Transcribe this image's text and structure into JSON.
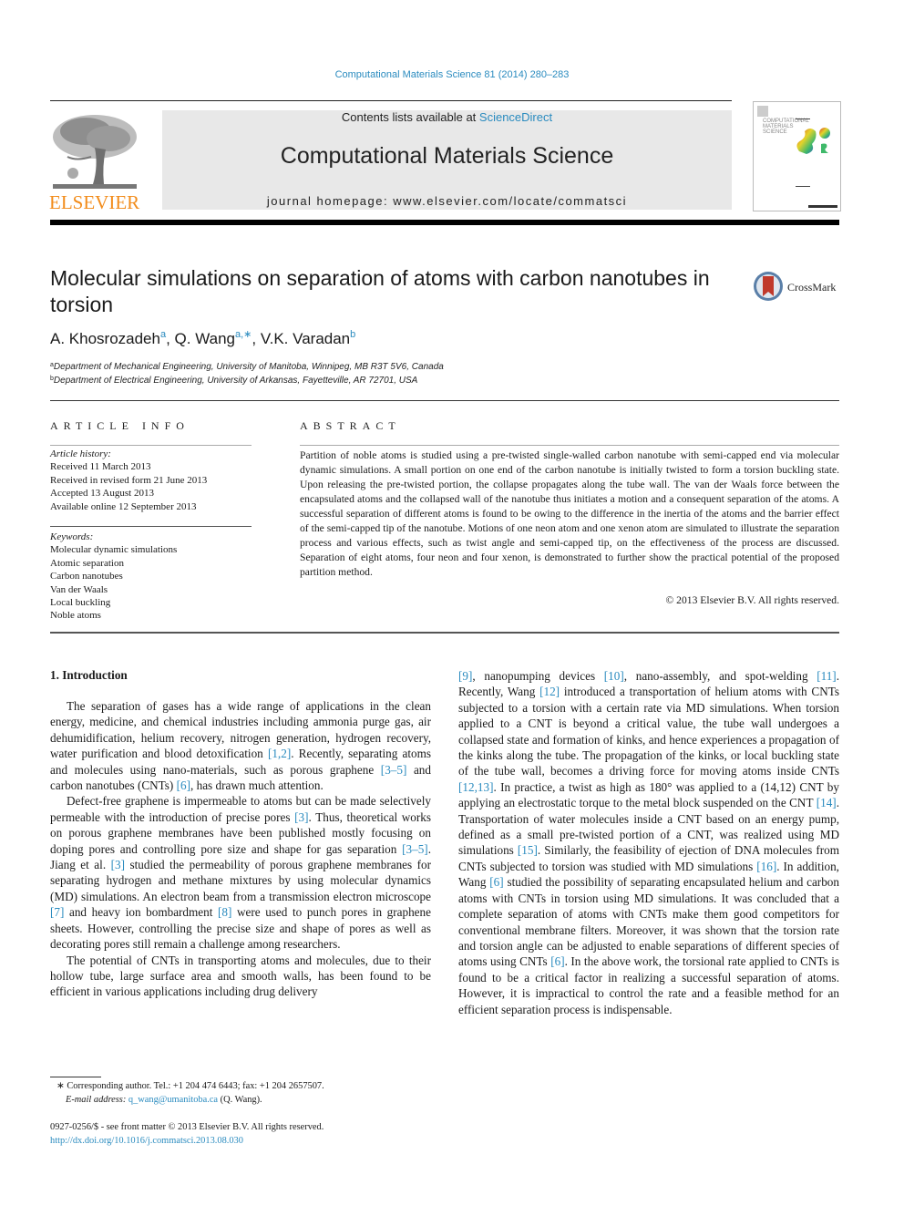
{
  "journal_ref": "Computational Materials Science 81 (2014) 280–283",
  "header": {
    "publisher_logo_text": "ELSEVIER",
    "contents_prefix": "Contents lists available at ",
    "contents_link": "ScienceDirect",
    "journal_name": "Computational Materials Science",
    "homepage_prefix": "journal homepage: ",
    "homepage_url": "www.elsevier.com/locate/commatsci",
    "cover_title": "COMPUTATIONAL MATERIALS SCIENCE"
  },
  "article": {
    "title": "Molecular simulations on separation of atoms with carbon nanotubes in torsion",
    "crossmark_label": "CrossMark",
    "authors": [
      {
        "name": "A. Khosrozadeh",
        "sup": "a"
      },
      {
        "name": "Q. Wang",
        "sup": "a,∗"
      },
      {
        "name": "V.K. Varadan",
        "sup": "b"
      }
    ],
    "affiliations": [
      {
        "sup": "a",
        "text": "Department of Mechanical Engineering, University of Manitoba, Winnipeg, MB R3T 5V6, Canada"
      },
      {
        "sup": "b",
        "text": "Department of Electrical Engineering, University of Arkansas, Fayetteville, AR 72701, USA"
      }
    ]
  },
  "article_info": {
    "heading": "ARTICLE INFO",
    "history_label": "Article history:",
    "history": [
      "Received 11 March 2013",
      "Received in revised form 21 June 2013",
      "Accepted 13 August 2013",
      "Available online 12 September 2013"
    ],
    "keywords_label": "Keywords:",
    "keywords": [
      "Molecular dynamic simulations",
      "Atomic separation",
      "Carbon nanotubes",
      "Van der Waals",
      "Local buckling",
      "Noble atoms"
    ]
  },
  "abstract": {
    "heading": "ABSTRACT",
    "text": "Partition of noble atoms is studied using a pre-twisted single-walled carbon nanotube with semi-capped end via molecular dynamic simulations. A small portion on one end of the carbon nanotube is initially twisted to form a torsion buckling state. Upon releasing the pre-twisted portion, the collapse propagates along the tube wall. The van der Waals force between the encapsulated atoms and the collapsed wall of the nanotube thus initiates a motion and a consequent separation of the atoms. A successful separation of different atoms is found to be owing to the difference in the inertia of the atoms and the barrier effect of the semi-capped tip of the nanotube. Motions of one neon atom and one xenon atom are simulated to illustrate the separation process and various effects, such as twist angle and semi-capped tip, on the effectiveness of the process are discussed. Separation of eight atoms, four neon and four xenon, is demonstrated to further show the practical potential of the proposed partition method.",
    "copyright": "© 2013 Elsevier B.V. All rights reserved."
  },
  "body": {
    "section_heading": "1. Introduction",
    "left_paragraphs": [
      [
        {
          "t": "The separation of gases has a wide range of applications in the clean energy, medicine, and chemical industries including ammonia purge gas, air dehumidification, helium recovery, nitrogen generation, hydrogen recovery, water purification and blood detoxification "
        },
        {
          "ref": "[1,2]"
        },
        {
          "t": ". Recently, separating atoms and molecules using nano-materials, such as porous graphene "
        },
        {
          "ref": "[3–5]"
        },
        {
          "t": " and carbon nanotubes (CNTs) "
        },
        {
          "ref": "[6]"
        },
        {
          "t": ", has drawn much attention."
        }
      ],
      [
        {
          "t": "Defect-free graphene is impermeable to atoms but can be made selectively permeable with the introduction of precise pores "
        },
        {
          "ref": "[3]"
        },
        {
          "t": ". Thus, theoretical works on porous graphene membranes have been published mostly focusing on doping pores and controlling pore size and shape for gas separation "
        },
        {
          "ref": "[3–5]"
        },
        {
          "t": ". Jiang et al. "
        },
        {
          "ref": "[3]"
        },
        {
          "t": " studied the permeability of porous graphene membranes for separating hydrogen and methane mixtures by using molecular dynamics (MD) simulations. An electron beam from a transmission electron microscope "
        },
        {
          "ref": "[7]"
        },
        {
          "t": " and heavy ion bombardment "
        },
        {
          "ref": "[8]"
        },
        {
          "t": " were used to punch pores in graphene sheets. However, controlling the precise size and shape of pores as well as decorating pores still remain a challenge among researchers."
        }
      ],
      [
        {
          "t": "The potential of CNTs in transporting atoms and molecules, due to their hollow tube, large surface area and smooth walls, has been found to be efficient in various applications including drug delivery"
        }
      ]
    ],
    "right_paragraphs": [
      [
        {
          "ref": "[9]"
        },
        {
          "t": ", nanopumping devices "
        },
        {
          "ref": "[10]"
        },
        {
          "t": ", nano-assembly, and spot-welding "
        },
        {
          "ref": "[11]"
        },
        {
          "t": ". Recently, Wang "
        },
        {
          "ref": "[12]"
        },
        {
          "t": " introduced a transportation of helium atoms with CNTs subjected to a torsion with a certain rate via MD simulations. When torsion applied to a CNT is beyond a critical value, the tube wall undergoes a collapsed state and formation of kinks, and hence experiences a propagation of the kinks along the tube. The propagation of the kinks, or local buckling state of the tube wall, becomes a driving force for moving atoms inside CNTs "
        },
        {
          "ref": "[12,13]"
        },
        {
          "t": ". In practice, a twist as high as 180° was applied to a (14,12) CNT by applying an electrostatic torque to the metal block suspended on the CNT "
        },
        {
          "ref": "[14]"
        },
        {
          "t": ". Transportation of water molecules inside a CNT based on an energy pump, defined as a small pre-twisted portion of a CNT, was realized using MD simulations "
        },
        {
          "ref": "[15]"
        },
        {
          "t": ". Similarly, the feasibility of ejection of DNA molecules from CNTs subjected to torsion was studied with MD simulations "
        },
        {
          "ref": "[16]"
        },
        {
          "t": ". In addition, Wang "
        },
        {
          "ref": "[6]"
        },
        {
          "t": " studied the possibility of separating encapsulated helium and carbon atoms with CNTs in torsion using MD simulations. It was concluded that a complete separation of atoms with CNTs make them good competitors for conventional membrane filters. Moreover, it was shown that the torsion rate and torsion angle can be adjusted to enable separations of different species of atoms using CNTs "
        },
        {
          "ref": "[6]"
        },
        {
          "t": ". In the above work, the torsional rate applied to CNTs is found to be a critical factor in realizing a successful separation of atoms. However, it is impractical to control the rate and a feasible method for an efficient separation process is indispensable."
        }
      ]
    ]
  },
  "footnote": {
    "marker": "∗",
    "corresponding": " Corresponding author. Tel.: +1 204 474 6443; fax: +1 204 2657507.",
    "email_label": "E-mail address: ",
    "email": "q_wang@umanitoba.ca",
    "email_suffix": " (Q. Wang)."
  },
  "front_matter": {
    "issn_line": "0927-0256/$ - see front matter © 2013 Elsevier B.V. All rights reserved.",
    "doi": "http://dx.doi.org/10.1016/j.commatsci.2013.08.030"
  },
  "colors": {
    "link": "#2a8bbf",
    "elsevier_orange": "#f28c1b",
    "banner_gray": "#e8e8e8",
    "crossmark_red": "#c0392b"
  }
}
